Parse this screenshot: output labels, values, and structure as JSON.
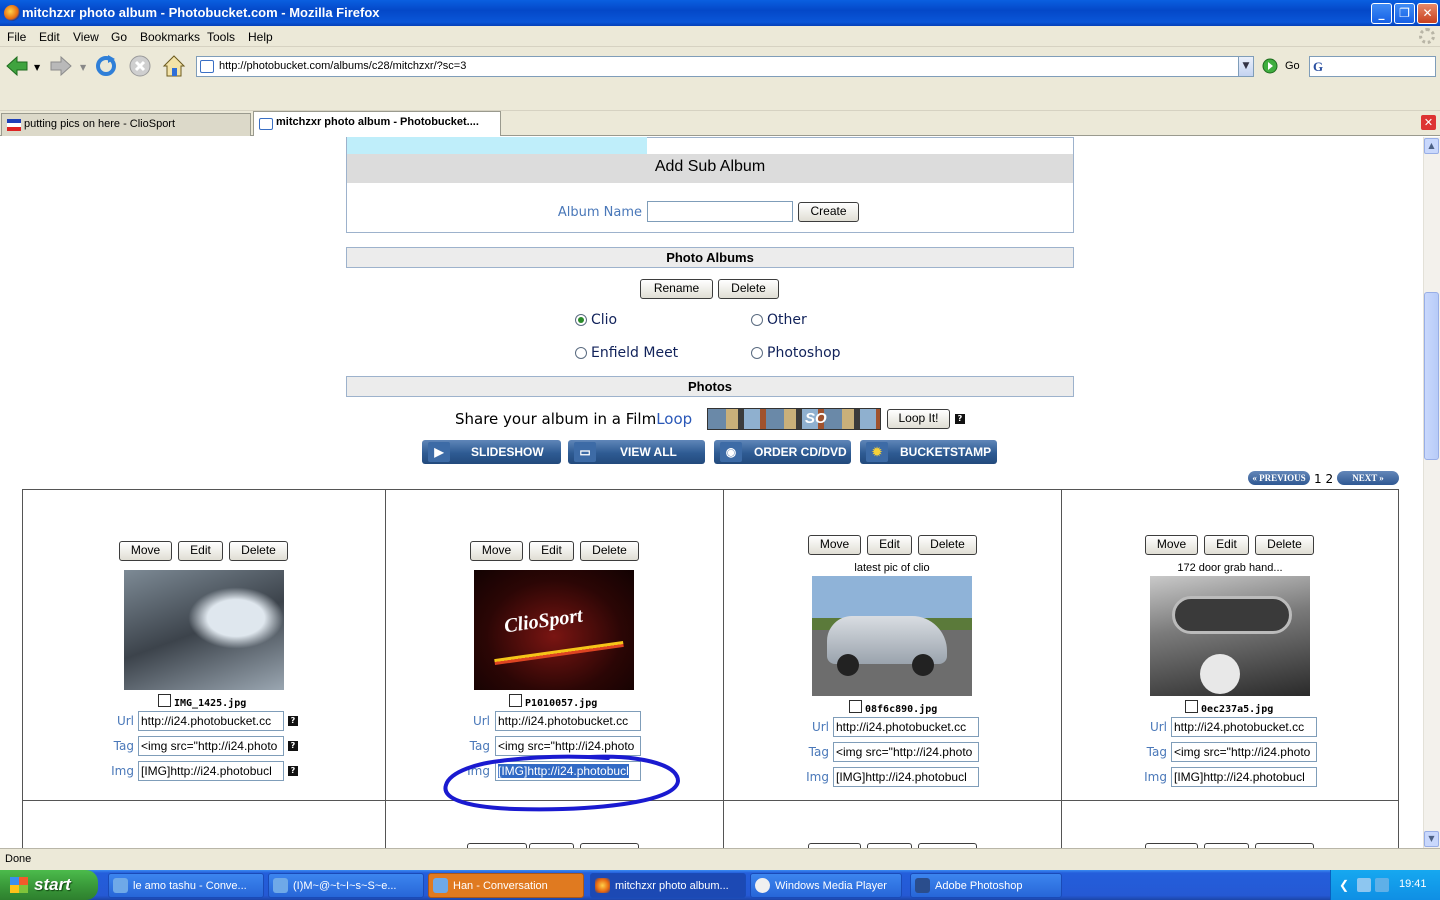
{
  "window": {
    "title": "mitchzxr photo album - Photobucket.com - Mozilla Firefox",
    "min": "_",
    "max": "❐",
    "close": "✕"
  },
  "menu": [
    "File",
    "Edit",
    "View",
    "Go",
    "Bookmarks",
    "Tools",
    "Help"
  ],
  "nav": {
    "url": "http://photobucket.com/albums/c28/mitchzxr/?sc=3",
    "go_label": "Go",
    "search_placeholder": ""
  },
  "tabs": [
    {
      "label": "putting pics on here - ClioSport",
      "selected": false
    },
    {
      "label": "mitchzxr photo album - Photobucket....",
      "selected": true
    }
  ],
  "sub_album": {
    "heading": "Add Sub Album",
    "name_label": "Album Name",
    "name_value": "",
    "create_button": "Create"
  },
  "photo_albums": {
    "heading": "Photo Albums",
    "rename_button": "Rename",
    "delete_button": "Delete",
    "albums": [
      {
        "name": "Clio",
        "selected": true
      },
      {
        "name": "Other",
        "selected": false
      },
      {
        "name": "Enfield Meet",
        "selected": false
      },
      {
        "name": "Photoshop",
        "selected": false
      }
    ]
  },
  "photos_section": {
    "heading": "Photos",
    "share_prefix": "Share your album in a Film",
    "share_suffix": "Loop",
    "loop_button": "Loop It!",
    "help": "?",
    "actions": [
      "SLIDESHOW",
      "VIEW ALL",
      "ORDER CD/DVD",
      "BUCKETSTAMP"
    ],
    "pager": {
      "prev": "« PREVIOUS",
      "pages": "1 2",
      "next": "NEXT »"
    }
  },
  "photo_cards": [
    {
      "filename": "IMG_1425.jpg",
      "caption": "",
      "url": "http://i24.photobucket.cc",
      "tag": "<img src=\"http://i24.photo",
      "img": "[IMG]http://i24.photobucl",
      "move": "Move",
      "edit": "Edit",
      "delete": "Delete",
      "label_url": "Url",
      "label_tag": "Tag",
      "label_img": "Img"
    },
    {
      "filename": "P1010057.jpg",
      "caption": "",
      "url": "http://i24.photobucket.cc",
      "tag": "<img src=\"http://i24.photo",
      "img": "[IMG]http://i24.photobucl",
      "move": "Move",
      "edit": "Edit",
      "delete": "Delete",
      "label_url": "Url",
      "label_tag": "Tag",
      "label_img": "Img",
      "img_selected": true
    },
    {
      "filename": "08f6c890.jpg",
      "caption": "latest pic of clio",
      "url": "http://i24.photobucket.cc",
      "tag": "<img src=\"http://i24.photo",
      "img": "[IMG]http://i24.photobucl",
      "move": "Move",
      "edit": "Edit",
      "delete": "Delete",
      "label_url": "Url",
      "label_tag": "Tag",
      "label_img": "Img"
    },
    {
      "filename": "0ec237a5.jpg",
      "caption": "172 door grab hand...",
      "url": "http://i24.photobucket.cc",
      "tag": "<img src=\"http://i24.photo",
      "img": "[IMG]http://i24.photobucl",
      "move": "Move",
      "edit": "Edit",
      "delete": "Delete",
      "label_url": "Url",
      "label_tag": "Tag",
      "label_img": "Img"
    }
  ],
  "status": "Done",
  "taskbar": {
    "start": "start",
    "tasks": [
      "le amo tashu - Conve...",
      "(I)M~@~t~I~s~S~e...",
      "Han - Conversation",
      "mitchzxr photo album...",
      "Windows Media Player",
      "Adobe Photoshop"
    ],
    "clock": "19:41"
  },
  "colors": {
    "link": "#4a78b9",
    "highlight": "#316ac5",
    "annotation": "#1a1ad0"
  }
}
